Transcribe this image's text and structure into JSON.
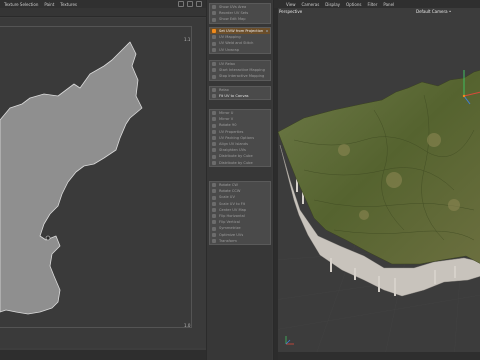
{
  "uv_editor": {
    "menu": [
      "Texture Selection",
      "Paint",
      "Textures"
    ],
    "corner_labels": {
      "top_right": "1.1",
      "bottom_right": "1.0"
    }
  },
  "commands": {
    "groups": [
      {
        "items": [
          {
            "label": "Show UVs Area",
            "state": "dim"
          },
          {
            "label": "Reorder UV Sets",
            "state": "dim"
          },
          {
            "label": "Show Edit Map",
            "state": "dim"
          }
        ]
      },
      {
        "items": [
          {
            "label": "Set UVW from Projection",
            "state": "active"
          },
          {
            "label": "UV Mapping",
            "state": "dim"
          },
          {
            "label": "UV Weld and Stitch",
            "state": "dim"
          },
          {
            "label": "UV Unwrap",
            "state": "dim"
          }
        ]
      },
      {
        "items": [
          {
            "label": "UV Relax",
            "state": "dim"
          },
          {
            "label": "Start Interactive Mapping",
            "state": "dim"
          },
          {
            "label": "Stop Interactive Mapping",
            "state": "dim"
          }
        ]
      },
      {
        "items": [
          {
            "label": "Relax",
            "state": "dim"
          },
          {
            "label": "Fit UV to Canvas",
            "state": "bright"
          }
        ]
      },
      {
        "items": [
          {
            "label": "Mirror U",
            "state": "dim"
          },
          {
            "label": "Mirror V",
            "state": "dim"
          },
          {
            "label": "Rotate 90",
            "state": "dim"
          },
          {
            "label": "UV Properties",
            "state": "dim"
          },
          {
            "label": "UV Packing Options",
            "state": "dim"
          },
          {
            "label": "Align UV Islands",
            "state": "dim"
          },
          {
            "label": "Straighten UVs",
            "state": "dim"
          },
          {
            "label": "Distribute by Cube",
            "state": "dim"
          },
          {
            "label": "Distribute by Cube",
            "state": "dim"
          }
        ]
      },
      {
        "items": [
          {
            "label": "Rotate CW",
            "state": "dim"
          },
          {
            "label": "Rotate CCW",
            "state": "dim"
          },
          {
            "label": "Scale UV",
            "state": "dim"
          },
          {
            "label": "Scale UV to Fit",
            "state": "dim"
          },
          {
            "label": "Center UV Map",
            "state": "dim"
          },
          {
            "label": "Flip Horizontal",
            "state": "dim"
          },
          {
            "label": "Flip Vertical",
            "state": "dim"
          },
          {
            "label": "Symmetrize",
            "state": "dim"
          },
          {
            "label": "Optimize UVs",
            "state": "dim"
          },
          {
            "label": "Transform",
            "state": "dim"
          }
        ]
      }
    ]
  },
  "viewport": {
    "menu": [
      "View",
      "Cameras",
      "Display",
      "Options",
      "Filter",
      "Panel"
    ],
    "view_name": "Perspective",
    "camera_name": "Default Camera •"
  },
  "colors": {
    "active_highlight": "#6b4e2a",
    "accent_orange": "#f08a1c",
    "terrain_green": "#5f6d3a",
    "extrusion_light": "#c8c3bc"
  }
}
